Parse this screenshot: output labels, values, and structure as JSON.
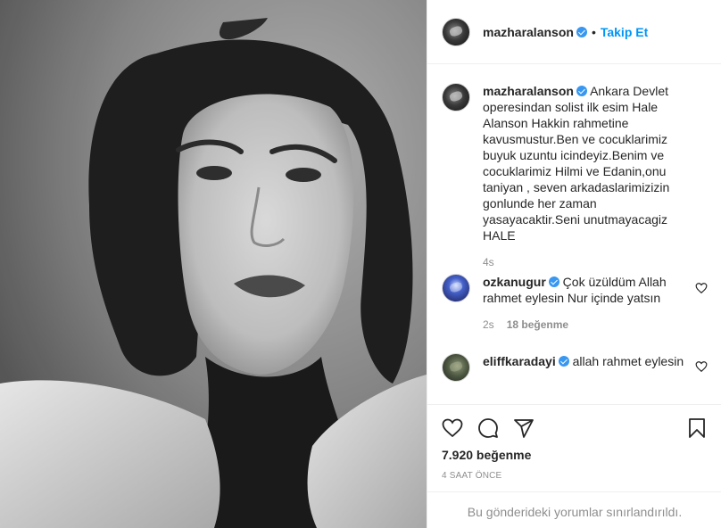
{
  "header": {
    "username": "mazharalanson",
    "separator": "•",
    "follow_label": "Takip Et"
  },
  "caption": {
    "username": "mazharalanson",
    "text": "Ankara Devlet operesindan solist ilk esim Hale Alanson Hakkin rahmetine kavusmustur.Ben ve cocuklarimiz buyuk uzuntu icindeyiz.Benim ve cocuklarimiz Hilmi ve Edanin,onu taniyan , seven arkadaslarimizizin gonlunde her zaman yasayacaktir.Seni unutmayacagiz HALE",
    "time": "4s"
  },
  "comments": [
    {
      "username": "ozkanugur",
      "text": "Çok üzüldüm Allah rahmet eylesin Nur içinde yatsın",
      "time": "2s",
      "likes": "18 beğenme"
    },
    {
      "username": "eliffkaradayi",
      "text": "allah rahmet eylesin",
      "time": "",
      "likes": ""
    }
  ],
  "post": {
    "likes": "7.920 beğenme",
    "time": "4 SAAT ÖNCE",
    "comments_limited": "Bu gönderideki yorumlar sınırlandırıldı."
  },
  "icons": {
    "like": "heart-icon",
    "comment": "comment-icon",
    "share": "share-icon",
    "save": "bookmark-icon"
  },
  "colors": {
    "accent": "#0095f6",
    "verified": "#3897f0",
    "muted": "#8e8e8e",
    "border": "#efefef"
  }
}
